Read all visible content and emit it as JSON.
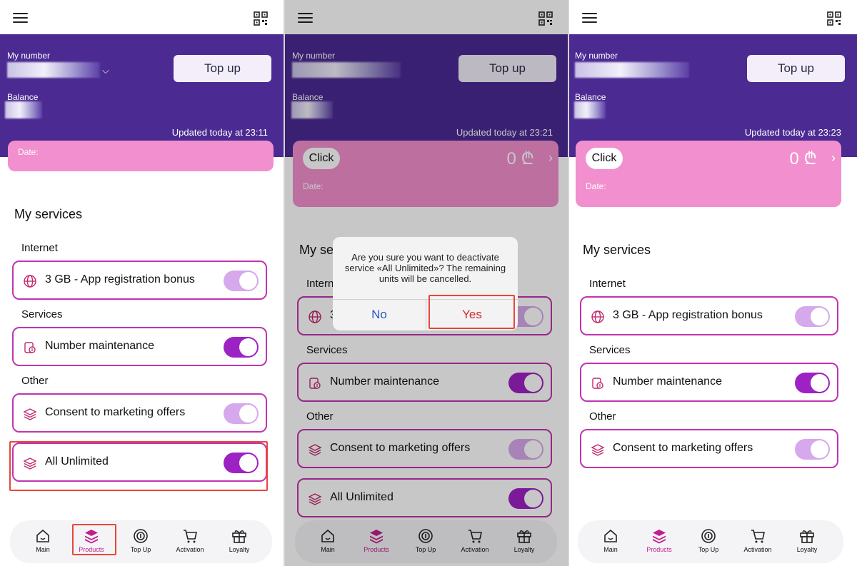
{
  "colors": {
    "header": "#4b2a92",
    "pink_card": "#f28fce",
    "accent_border": "#c233b0",
    "toggle_on": "#9d22c3",
    "toggle_faded": "#d6a8ec",
    "highlight_box": "#e8463a"
  },
  "common": {
    "my_number_label": "My number",
    "balance_label": "Balance",
    "topup_label": "Top up",
    "date_label": "Date:",
    "click_label": "Click",
    "card_balance": "0 ₾",
    "my_services": "My services",
    "internet_title": "Internet",
    "services_title": "Services",
    "other_title": "Other",
    "internet_service": "3 GB - App registration bonus",
    "number_maintenance": "Number maintenance",
    "consent": "Consent to marketing offers",
    "all_unlimited": "All Unlimited"
  },
  "panels": [
    {
      "updated": "Updated today at 23:11"
    },
    {
      "updated": "Updated today at 23:21"
    },
    {
      "updated": "Updated today at 23:23"
    }
  ],
  "dialog": {
    "message": "Are you sure you want to deactivate service «All Unlimited»? The remaining units will be cancelled.",
    "no": "No",
    "yes": "Yes"
  },
  "nav": [
    {
      "label": "Main",
      "icon": "home-icon"
    },
    {
      "label": "Products",
      "icon": "layers-icon"
    },
    {
      "label": "Top Up",
      "icon": "topup-icon"
    },
    {
      "label": "Activation",
      "icon": "cart-icon"
    },
    {
      "label": "Loyalty",
      "icon": "gift-icon"
    }
  ]
}
